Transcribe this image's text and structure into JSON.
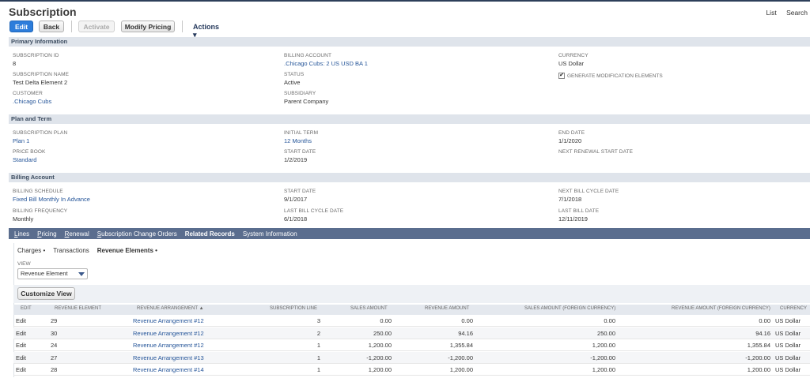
{
  "page": {
    "title": "Subscription",
    "top_links": [
      "List",
      "Search"
    ]
  },
  "toolbar": {
    "edit": "Edit",
    "back": "Back",
    "activate": "Activate",
    "modify_pricing": "Modify Pricing",
    "actions": "Actions ▾"
  },
  "primary": {
    "header": "Primary Information",
    "subscription_id_label": "SUBSCRIPTION ID",
    "subscription_id": "8",
    "billing_account_label": "BILLING ACCOUNT",
    "billing_account": ".Chicago Cubs: 2 US USD BA 1",
    "currency_label": "CURRENCY",
    "currency": "US Dollar",
    "subscription_name_label": "SUBSCRIPTION NAME",
    "subscription_name": "Test Delta Element 2",
    "status_label": "STATUS",
    "status": "Active",
    "gen_mod_label": "GENERATE MODIFICATION ELEMENTS",
    "gen_mod_checked": "✔",
    "customer_label": "CUSTOMER",
    "customer": ".Chicago Cubs",
    "subsidiary_label": "SUBSIDIARY",
    "subsidiary": "Parent Company"
  },
  "plan": {
    "header": "Plan and Term",
    "plan_label": "SUBSCRIPTION PLAN",
    "plan": "Plan 1",
    "initial_term_label": "INITIAL TERM",
    "initial_term": "12 Months",
    "end_date_label": "END DATE",
    "end_date": "1/1/2020",
    "price_book_label": "PRICE BOOK",
    "price_book": "Standard",
    "start_date_label": "START DATE",
    "start_date": "1/2/2019",
    "next_renewal_label": "NEXT RENEWAL START DATE"
  },
  "billing": {
    "header": "Billing Account",
    "schedule_label": "BILLING SCHEDULE",
    "schedule": "Fixed Bill Monthly In Advance",
    "start_date_label": "START DATE",
    "start_date": "9/1/2017",
    "next_bill_cycle_label": "NEXT BILL CYCLE DATE",
    "next_bill_cycle": "7/1/2018",
    "frequency_label": "BILLING FREQUENCY",
    "frequency": "Monthly",
    "last_bill_cycle_label": "LAST BILL CYCLE DATE",
    "last_bill_cycle": "6/1/2018",
    "last_bill_date_label": "LAST BILL DATE",
    "last_bill_date": "12/11/2019"
  },
  "tabs": [
    {
      "first": "L",
      "rest": "ines"
    },
    {
      "first": "P",
      "rest": "ricing"
    },
    {
      "first": "R",
      "rest": "enewal"
    },
    {
      "first": "S",
      "rest": "ubscription Change Orders"
    },
    {
      "first": "",
      "rest": "Related Records"
    },
    {
      "first": "",
      "rest": "System Information"
    }
  ],
  "subtabs": {
    "charges": "Charges •",
    "transactions": "Transactions",
    "revenue_elements": "Revenue Elements •"
  },
  "view": {
    "label": "VIEW",
    "selected": "Revenue Element"
  },
  "customize_view": "Customize View",
  "table": {
    "headers": [
      "EDIT",
      "REVENUE ELEMENT",
      "REVENUE ARRANGEMENT ▲",
      "SUBSCRIPTION LINE",
      "SALES AMOUNT",
      "REVENUE AMOUNT",
      "SALES AMOUNT (FOREIGN CURRENCY)",
      "REVENUE AMOUNT (FOREIGN CURRENCY)",
      "CURRENCY"
    ],
    "rows": [
      {
        "edit": "Edit",
        "element": "29",
        "arrangement": "Revenue Arrangement #12",
        "line": "3",
        "sales": "0.00",
        "revenue": "0.00",
        "sales_fc": "0.00",
        "revenue_fc": "0.00",
        "currency": "US Dollar"
      },
      {
        "edit": "Edit",
        "element": "30",
        "arrangement": "Revenue Arrangement #12",
        "line": "2",
        "sales": "250.00",
        "revenue": "94.16",
        "sales_fc": "250.00",
        "revenue_fc": "94.16",
        "currency": "US Dollar"
      },
      {
        "edit": "Edit",
        "element": "24",
        "arrangement": "Revenue Arrangement #12",
        "line": "1",
        "sales": "1,200.00",
        "revenue": "1,355.84",
        "sales_fc": "1,200.00",
        "revenue_fc": "1,355.84",
        "currency": "US Dollar"
      },
      {
        "edit": "Edit",
        "element": "27",
        "arrangement": "Revenue Arrangement #13",
        "line": "1",
        "sales": "-1,200.00",
        "revenue": "-1,200.00",
        "sales_fc": "-1,200.00",
        "revenue_fc": "-1,200.00",
        "currency": "US Dollar"
      },
      {
        "edit": "Edit",
        "element": "28",
        "arrangement": "Revenue Arrangement #14",
        "line": "1",
        "sales": "1,200.00",
        "revenue": "1,200.00",
        "sales_fc": "1,200.00",
        "revenue_fc": "1,200.00",
        "currency": "US Dollar"
      }
    ]
  },
  "colors": {
    "primary_button": "#2d7ddb",
    "link": "#255599",
    "tab_bar": "#5a6d8e",
    "section_header": "#dfe4eb"
  }
}
